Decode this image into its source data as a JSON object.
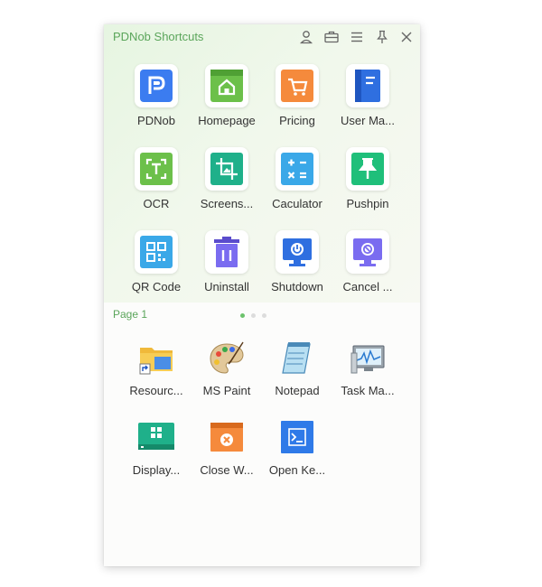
{
  "window": {
    "title": "PDNob Shortcuts"
  },
  "toolbar": {
    "icons": [
      "user-icon",
      "toolbox-icon",
      "menu-icon",
      "pin-icon",
      "close-icon"
    ]
  },
  "shortcuts": [
    {
      "label": "PDNob",
      "icon": "pdnob-icon",
      "color": "#3b7cf0"
    },
    {
      "label": "Homepage",
      "icon": "homepage-icon",
      "color": "#6cc04a"
    },
    {
      "label": "Pricing",
      "icon": "pricing-cart-icon",
      "color": "#f58a3c"
    },
    {
      "label": "User Ma...",
      "icon": "user-manual-icon",
      "color": "#2f6fe0"
    },
    {
      "label": "OCR",
      "icon": "ocr-icon",
      "color": "#6cc04a"
    },
    {
      "label": "Screens...",
      "icon": "screenshot-icon",
      "color": "#1fb08a"
    },
    {
      "label": "Caculator",
      "icon": "calculator-icon",
      "color": "#3aa8e8"
    },
    {
      "label": "Pushpin",
      "icon": "pushpin-icon",
      "color": "#1fbf7a"
    },
    {
      "label": "QR Code",
      "icon": "qr-code-icon",
      "color": "#3aa8e8"
    },
    {
      "label": "Uninstall",
      "icon": "trash-icon",
      "color": "#7a6cf0"
    },
    {
      "label": "Shutdown",
      "icon": "shutdown-icon",
      "color": "#2f6fe0"
    },
    {
      "label": "Cancel ...",
      "icon": "cancel-shutdown-icon",
      "color": "#7a6cf0"
    }
  ],
  "pager": {
    "label": "Page 1",
    "pages": 3,
    "active": 1
  },
  "apps": [
    {
      "label": "Resourc...",
      "icon": "folder-shortcut-icon"
    },
    {
      "label": "MS Paint",
      "icon": "paint-palette-icon"
    },
    {
      "label": "Notepad",
      "icon": "notepad-icon"
    },
    {
      "label": "Task Ma...",
      "icon": "task-manager-icon"
    },
    {
      "label": "Display...",
      "icon": "display-icon"
    },
    {
      "label": "Close W...",
      "icon": "close-window-icon"
    },
    {
      "label": "Open Ke...",
      "icon": "keyboard-terminal-icon"
    }
  ]
}
